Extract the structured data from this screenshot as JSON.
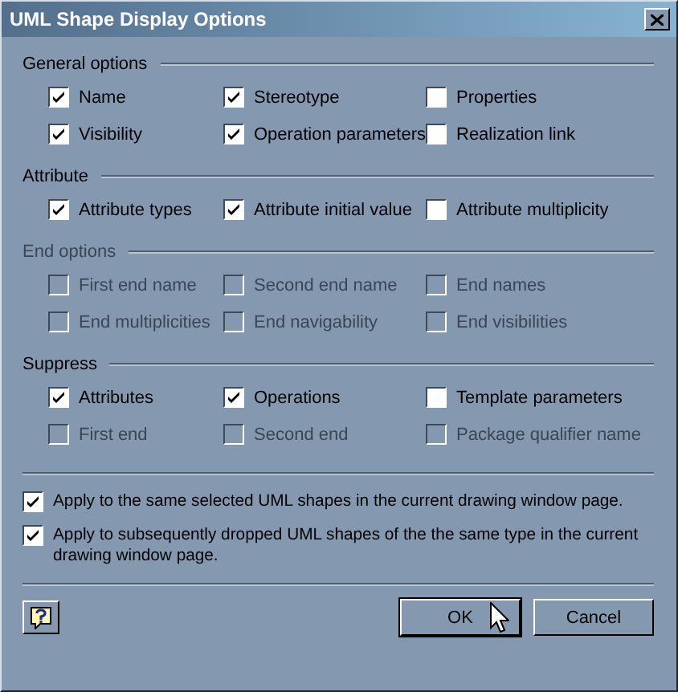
{
  "window": {
    "title": "UML Shape Display Options"
  },
  "sections": [
    {
      "title": "General options",
      "disabled": false,
      "items": [
        {
          "label": "Name",
          "checked": true,
          "disabled": false
        },
        {
          "label": "Stereotype",
          "checked": true,
          "disabled": false
        },
        {
          "label": "Properties",
          "checked": false,
          "disabled": false
        },
        {
          "label": "Visibility",
          "checked": true,
          "disabled": false
        },
        {
          "label": "Operation parameters",
          "checked": true,
          "disabled": false
        },
        {
          "label": "Realization link",
          "checked": false,
          "disabled": false
        }
      ]
    },
    {
      "title": "Attribute",
      "disabled": false,
      "items": [
        {
          "label": "Attribute types",
          "checked": true,
          "disabled": false
        },
        {
          "label": "Attribute initial value",
          "checked": true,
          "disabled": false
        },
        {
          "label": "Attribute multiplicity",
          "checked": false,
          "disabled": false
        }
      ]
    },
    {
      "title": "End options",
      "disabled": true,
      "items": [
        {
          "label": "First end name",
          "checked": false,
          "disabled": true
        },
        {
          "label": "Second end name",
          "checked": false,
          "disabled": true
        },
        {
          "label": "End names",
          "checked": false,
          "disabled": true
        },
        {
          "label": "End multiplicities",
          "checked": false,
          "disabled": true
        },
        {
          "label": "End navigability",
          "checked": false,
          "disabled": true
        },
        {
          "label": "End visibilities",
          "checked": false,
          "disabled": true
        }
      ]
    },
    {
      "title": "Suppress",
      "disabled": false,
      "items": [
        {
          "label": "Attributes",
          "checked": true,
          "disabled": false
        },
        {
          "label": "Operations",
          "checked": true,
          "disabled": false
        },
        {
          "label": "Template parameters",
          "checked": false,
          "disabled": false
        },
        {
          "label": "First end",
          "checked": false,
          "disabled": true
        },
        {
          "label": "Second end",
          "checked": false,
          "disabled": true
        },
        {
          "label": "Package qualifier name",
          "checked": false,
          "disabled": true
        }
      ]
    }
  ],
  "apply": [
    {
      "label": "Apply to the same selected UML shapes in the current drawing window page.",
      "checked": true
    },
    {
      "label": "Apply to subsequently dropped UML shapes of the the same type in the current drawing window page.",
      "checked": true
    }
  ],
  "buttons": [
    {
      "label": "OK",
      "default": true
    },
    {
      "label": "Cancel",
      "default": false
    }
  ]
}
